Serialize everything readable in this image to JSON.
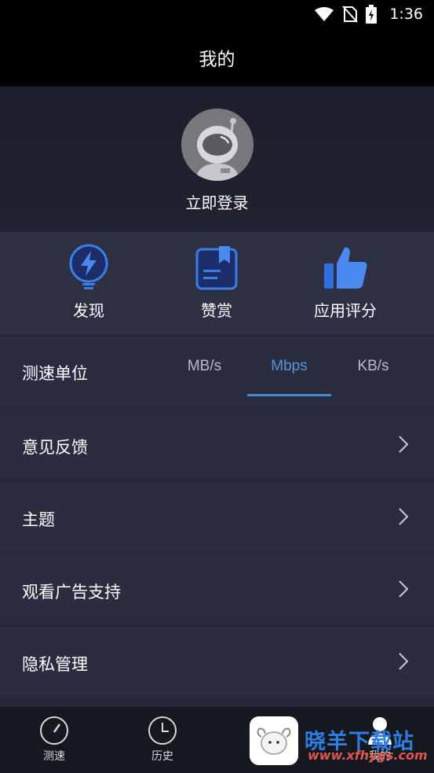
{
  "status_bar": {
    "time": "1:36",
    "icons": [
      "wifi-icon",
      "no-sim-icon",
      "battery-charging-icon"
    ]
  },
  "header": {
    "title": "我的"
  },
  "profile": {
    "login_label": "立即登录",
    "avatar_icon": "astronaut-avatar-icon"
  },
  "quick_actions": [
    {
      "label": "发现",
      "icon": "lightning-bulb-icon"
    },
    {
      "label": "赞赏",
      "icon": "bookmark-book-icon"
    },
    {
      "label": "应用评分",
      "icon": "thumbs-up-icon"
    }
  ],
  "speed_unit": {
    "label": "测速单位",
    "options": [
      "MB/s",
      "Mbps",
      "KB/s"
    ],
    "selected": "Mbps"
  },
  "menu": [
    {
      "label": "意见反馈"
    },
    {
      "label": "主题"
    },
    {
      "label": "观看广告支持"
    },
    {
      "label": "隐私管理"
    }
  ],
  "bottom_nav": [
    {
      "label": "测速",
      "icon": "speedometer-icon"
    },
    {
      "label": "历史",
      "icon": "clock-icon"
    },
    {
      "label": "我的",
      "icon": "user-icon",
      "active": true
    }
  ],
  "watermark": {
    "text": "晓羊下载站",
    "url": "www.xfhygs.com"
  },
  "colors": {
    "accent": "#4e86d6",
    "background": "#25283a",
    "header": "#000000"
  }
}
